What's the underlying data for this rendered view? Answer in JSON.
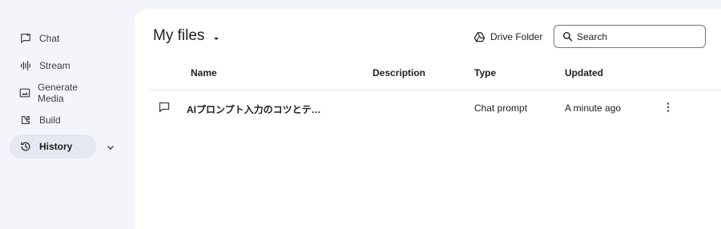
{
  "sidebar": {
    "items": [
      {
        "label": "Chat",
        "icon": "chat-icon"
      },
      {
        "label": "Stream",
        "icon": "stream-icon"
      },
      {
        "label": "Generate Media",
        "icon": "generate-media-icon"
      },
      {
        "label": "Build",
        "icon": "build-icon"
      },
      {
        "label": "History",
        "icon": "history-icon",
        "active": true
      }
    ]
  },
  "header": {
    "title": "My files",
    "drive_folder_label": "Drive Folder",
    "search_placeholder": "Search"
  },
  "table": {
    "columns": [
      "Name",
      "Description",
      "Type",
      "Updated"
    ],
    "rows": [
      {
        "name": "AIプロンプト入力のコツとテ…",
        "description": "",
        "type": "Chat prompt",
        "updated": "A minute ago",
        "icon": "chat-bubble-icon"
      }
    ]
  },
  "colors": {
    "sidebar_bg": "#f3f5fa",
    "active_item_bg": "#e4e8f0",
    "main_bg": "#ffffff"
  }
}
